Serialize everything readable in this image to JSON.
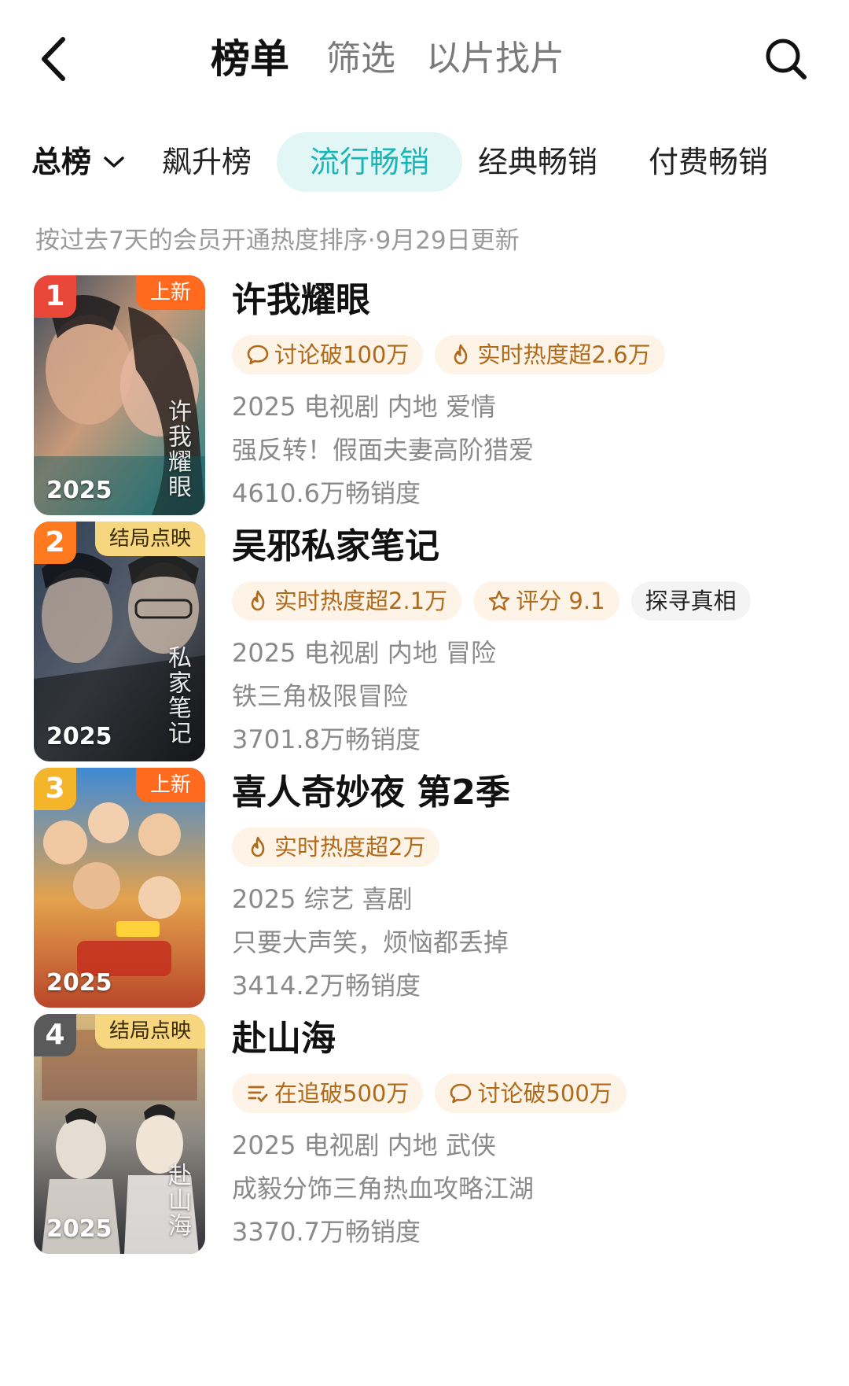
{
  "header": {
    "tabs": [
      {
        "label": "榜单",
        "active": true
      },
      {
        "label": "筛选",
        "active": false
      },
      {
        "label": "以片找片",
        "active": false
      }
    ],
    "back_icon": "chevron-left-icon",
    "search_icon": "search-icon"
  },
  "categories": [
    {
      "label": "总榜",
      "dropdown": true
    },
    {
      "label": "飙升榜"
    },
    {
      "label": "流行畅销",
      "active": true
    },
    {
      "label": "经典畅销"
    },
    {
      "label": "付费畅销"
    }
  ],
  "hint": "按过去7天的会员开通热度排序·9月29日更新",
  "colors": {
    "accent": "#1bb5b5",
    "tag_bg": "#fdf3e6",
    "tag_text": "#b06a1b",
    "rank1": "#e8473a",
    "rank2": "#ff7a1f",
    "rank3": "#f5b52a",
    "rank4": "#5a5a5a"
  },
  "items": [
    {
      "rank": "1",
      "badge": "上新",
      "badge_type": "new",
      "year": "2025",
      "poster_title": "许我耀眼",
      "title": "许我耀眼",
      "tags": [
        {
          "icon": "comment-icon",
          "text": "讨论破100万"
        },
        {
          "icon": "flame-icon",
          "text": "实时热度超2.6万"
        }
      ],
      "meta": "2025 电视剧 内地 爱情",
      "desc": "强反转！假面夫妻高阶猎爱",
      "sales": "4610.6万畅销度"
    },
    {
      "rank": "2",
      "badge": "结局点映",
      "badge_type": "final",
      "year": "2025",
      "poster_title": "私家笔记",
      "title": "吴邪私家笔记",
      "tags": [
        {
          "icon": "flame-icon",
          "text": "实时热度超2.1万"
        },
        {
          "icon": "star-icon",
          "text": "评分 9.1"
        },
        {
          "icon": "",
          "text": "探寻真相",
          "plain": true
        }
      ],
      "meta": "2025 电视剧 内地 冒险",
      "desc": "铁三角极限冒险",
      "sales": "3701.8万畅销度"
    },
    {
      "rank": "3",
      "badge": "上新",
      "badge_type": "new",
      "year": "2025",
      "poster_title": "喜人奇妙夜",
      "title": "喜人奇妙夜 第2季",
      "tags": [
        {
          "icon": "flame-icon",
          "text": "实时热度超2万"
        }
      ],
      "meta": "2025 综艺 喜剧",
      "desc": "只要大声笑，烦恼都丢掉",
      "sales": "3414.2万畅销度"
    },
    {
      "rank": "4",
      "badge": "结局点映",
      "badge_type": "final",
      "year": "2025",
      "poster_title": "赴山海",
      "title": "赴山海",
      "tags": [
        {
          "icon": "list-icon",
          "text": "在追破500万"
        },
        {
          "icon": "comment-icon",
          "text": "讨论破500万"
        }
      ],
      "meta": "2025 电视剧 内地 武侠",
      "desc": "成毅分饰三角热血攻略江湖",
      "sales": "3370.7万畅销度"
    }
  ]
}
